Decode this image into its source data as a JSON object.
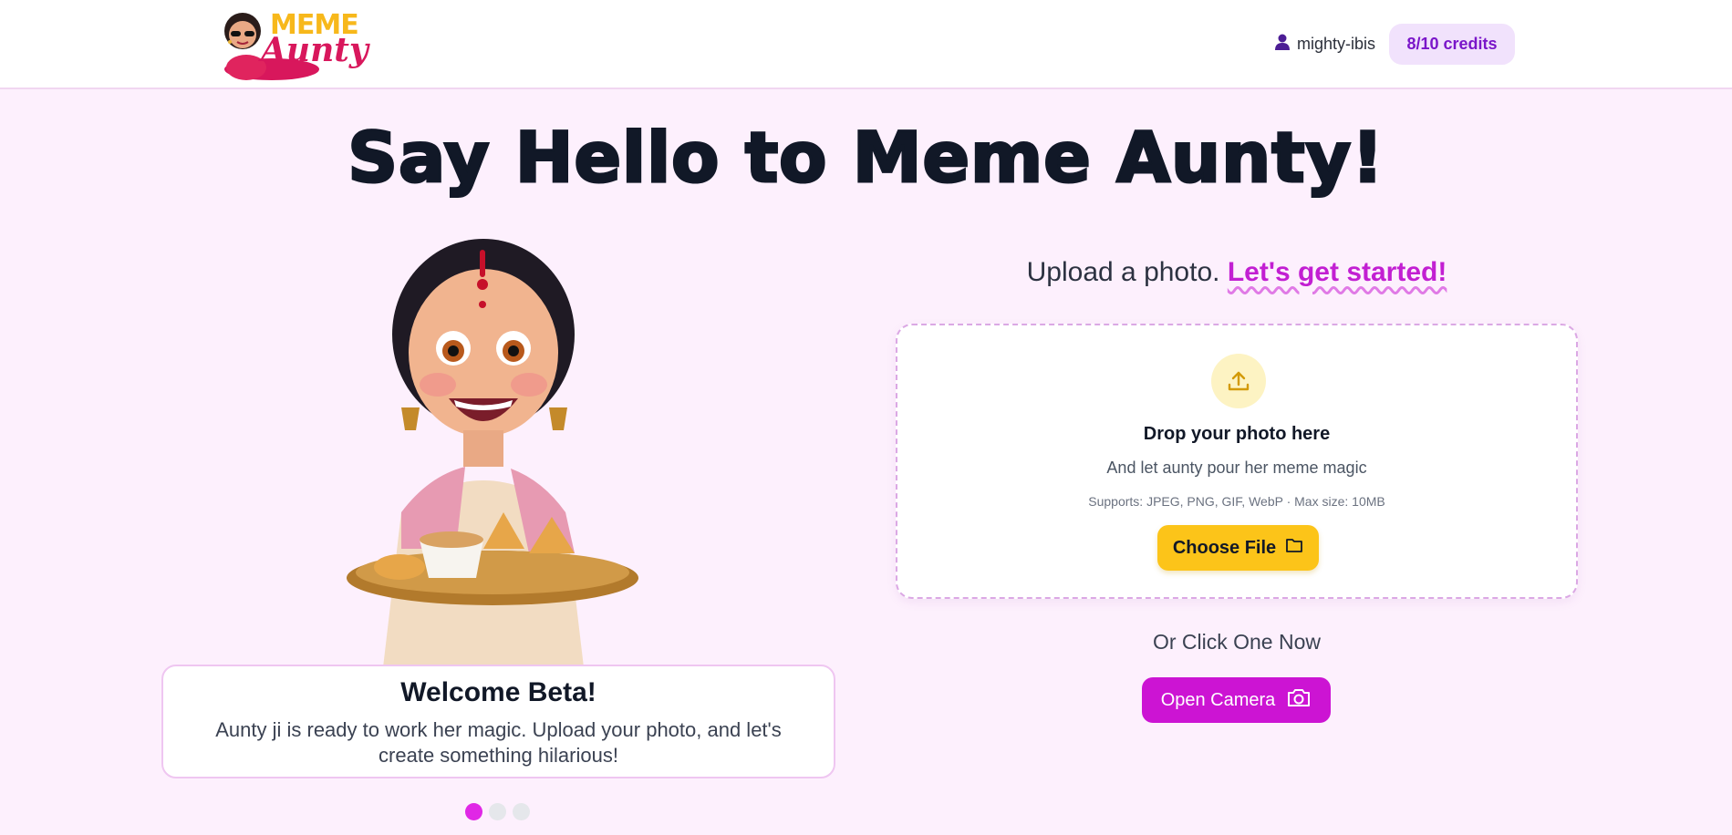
{
  "header": {
    "logo_line1": "MEME",
    "logo_line2": "Aunty",
    "username": "mighty-ibis",
    "credits": "8/10 credits"
  },
  "title": "Say Hello to Meme Aunty!",
  "upload": {
    "heading_plain": "Upload a photo.",
    "heading_accent": "Let's get started!",
    "drop_title": "Drop your photo here",
    "drop_subtitle": "And let aunty pour her meme magic",
    "supports": "Supports: JPEG, PNG, GIF, WebP · Max size: 10MB",
    "choose_file_label": "Choose File",
    "or_click": "Or Click One Now",
    "open_camera_label": "Open Camera"
  },
  "welcome": {
    "title": "Welcome Beta!",
    "text": "Aunty ji is ready to work her magic. Upload your photo, and let's create something hilarious!"
  },
  "carousel": {
    "active_index": 0,
    "count": 3
  },
  "colors": {
    "background": "#fdf0fd",
    "accent_purple": "#cc14d3",
    "accent_yellow": "#fcc419",
    "credits_text": "#7a16c9"
  },
  "icons": {
    "user": "user-icon",
    "upload": "upload-icon",
    "folder": "folder-icon",
    "camera": "camera-icon"
  }
}
